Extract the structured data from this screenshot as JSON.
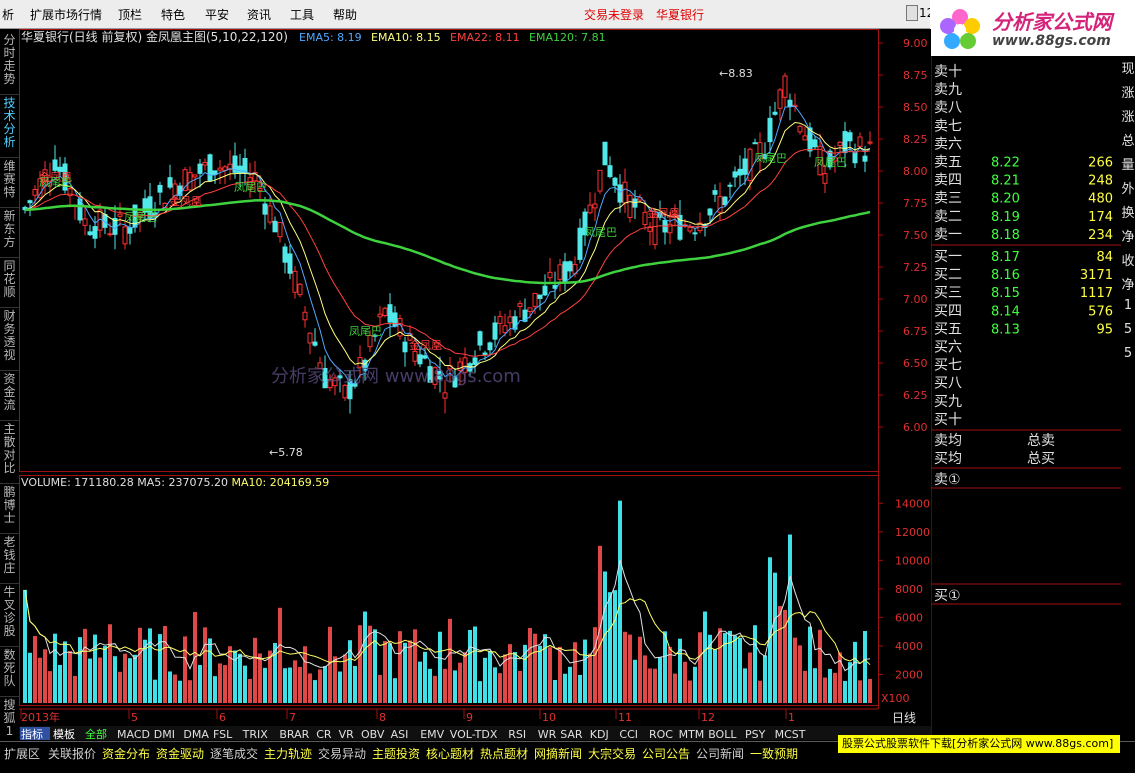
{
  "menu": {
    "items": [
      "析",
      "扩展市场行情",
      "顶栏",
      "特色",
      "平安",
      "资讯",
      "工具",
      "帮助"
    ],
    "status_login": "交易未登录",
    "stock_name": "华夏银行",
    "corner_text": "12"
  },
  "logo": {
    "title": "分析家公式网",
    "url": "www.88gs.com"
  },
  "left_nav": [
    {
      "label": "分时走势",
      "active": false
    },
    {
      "label": "技术分析",
      "active": true
    },
    {
      "label": "维赛特",
      "active": false
    },
    {
      "label": "新东方",
      "active": false
    },
    {
      "label": "同花顺",
      "active": false
    },
    {
      "label": "财务透视",
      "active": false
    },
    {
      "label": "资金流",
      "active": false
    },
    {
      "label": "主散对比",
      "active": false
    },
    {
      "label": "鹏博士",
      "active": false
    },
    {
      "label": "老钱庄",
      "active": false
    },
    {
      "label": "牛叉诊股",
      "active": false
    },
    {
      "label": "数死队",
      "active": false
    },
    {
      "label": "搜狐1",
      "active": false
    }
  ],
  "chart_data": {
    "type": "candlestick",
    "title": "华夏银行(日线 前复权) 金凤凰主图(5,10,22,120)",
    "indicators": [
      {
        "name": "EMA5",
        "value": "8.19",
        "color": "#4fa8ff"
      },
      {
        "name": "EMA10",
        "value": "8.15",
        "color": "#ffff80"
      },
      {
        "name": "EMA22",
        "value": "8.11",
        "color": "#ff4040"
      },
      {
        "name": "EMA120",
        "value": "7.81",
        "color": "#3fd23f"
      }
    ],
    "price_axis": [
      "9.00",
      "8.75",
      "8.50",
      "8.25",
      "8.00",
      "7.75",
      "7.50",
      "7.25",
      "7.00",
      "6.75",
      "6.50",
      "6.25",
      "6.00"
    ],
    "ylim": [
      6.0,
      9.0
    ],
    "high_label": "8.83",
    "low_label": "5.78",
    "signal_labels": [
      {
        "text": "金凤凰",
        "color": "#ff4040"
      },
      {
        "text": "凤尾巴",
        "color": "#3fd23f"
      },
      {
        "text": "凤尾巴",
        "color": "#3fd23f"
      },
      {
        "text": "金凤凰",
        "color": "#ff4040"
      },
      {
        "text": "凤尾巴",
        "color": "#3fd23f"
      },
      {
        "text": "凤尾巴",
        "color": "#3fd23f"
      },
      {
        "text": "金凤凰",
        "color": "#ff4040"
      },
      {
        "text": "凤尾巴",
        "color": "#3fd23f"
      },
      {
        "text": "金凤凰",
        "color": "#ff4040"
      },
      {
        "text": "凤尾巴",
        "color": "#3fd23f"
      },
      {
        "text": "凤尾巴",
        "color": "#3fd23f"
      }
    ],
    "watermark": "分析家公式网 www.88gs.com",
    "volume": {
      "label": "VOLUME",
      "value": "171180.28",
      "ma5_label": "MA5",
      "ma5": "237075.20",
      "ma10_label": "MA10",
      "ma10": "204169.59",
      "axis": [
        "14000",
        "12000",
        "10000",
        "8000",
        "6000",
        "4000",
        "2000"
      ],
      "unit": "X100"
    },
    "x_labels": [
      "2013年",
      "5",
      "6",
      "7",
      "8",
      "9",
      "10",
      "11",
      "12",
      "1"
    ],
    "period": "日线"
  },
  "indicator_tabs": [
    "指标",
    "模板",
    "全部",
    "MACD",
    "DMI",
    "DMA",
    "FSL",
    "TRIX",
    "BRAR",
    "CR",
    "VR",
    "OBV",
    "ASI",
    "EMV",
    "VOL-TDX",
    "RSI",
    "WR",
    "SAR",
    "KDJ",
    "CCI",
    "ROC",
    "MTM",
    "BOLL",
    "PSY",
    "MCST"
  ],
  "quote": {
    "sell": [
      {
        "label": "卖十",
        "price": "",
        "vol": ""
      },
      {
        "label": "卖九",
        "price": "",
        "vol": ""
      },
      {
        "label": "卖八",
        "price": "",
        "vol": ""
      },
      {
        "label": "卖七",
        "price": "",
        "vol": ""
      },
      {
        "label": "卖六",
        "price": "",
        "vol": ""
      },
      {
        "label": "卖五",
        "price": "8.22",
        "vol": "266"
      },
      {
        "label": "卖四",
        "price": "8.21",
        "vol": "248"
      },
      {
        "label": "卖三",
        "price": "8.20",
        "vol": "480"
      },
      {
        "label": "卖二",
        "price": "8.19",
        "vol": "174"
      },
      {
        "label": "卖一",
        "price": "8.18",
        "vol": "234"
      }
    ],
    "buy": [
      {
        "label": "买一",
        "price": "8.17",
        "vol": "84"
      },
      {
        "label": "买二",
        "price": "8.16",
        "vol": "3171"
      },
      {
        "label": "买三",
        "price": "8.15",
        "vol": "1117"
      },
      {
        "label": "买四",
        "price": "8.14",
        "vol": "576"
      },
      {
        "label": "买五",
        "price": "8.13",
        "vol": "95"
      },
      {
        "label": "买六",
        "price": "",
        "vol": ""
      },
      {
        "label": "买七",
        "price": "",
        "vol": ""
      },
      {
        "label": "买八",
        "price": "",
        "vol": ""
      },
      {
        "label": "买九",
        "price": "",
        "vol": ""
      },
      {
        "label": "买十",
        "price": "",
        "vol": ""
      }
    ],
    "sell_avg": "卖均",
    "buy_avg": "买均",
    "total_sell": "总卖",
    "total_buy": "总买",
    "sell_marker": "卖①",
    "buy_marker": "买①",
    "right_strip": [
      "现",
      "涨",
      "涨",
      "总",
      "量",
      "外",
      "换",
      "净",
      "收",
      "净",
      "1",
      "5",
      "5"
    ]
  },
  "bottom_tabs": [
    "扩展区",
    "关联报价",
    "资金分布",
    "资金驱动",
    "逐笔成交",
    "主力轨迹",
    "交易异动",
    "主题投资",
    "核心题材",
    "热点题材",
    "网摘新闻",
    "大宗交易",
    "公司公告",
    "公司新闻",
    "一致预期"
  ],
  "download_bar": "股票公式股票软件下载[分析家公式网 www.88gs.com]"
}
